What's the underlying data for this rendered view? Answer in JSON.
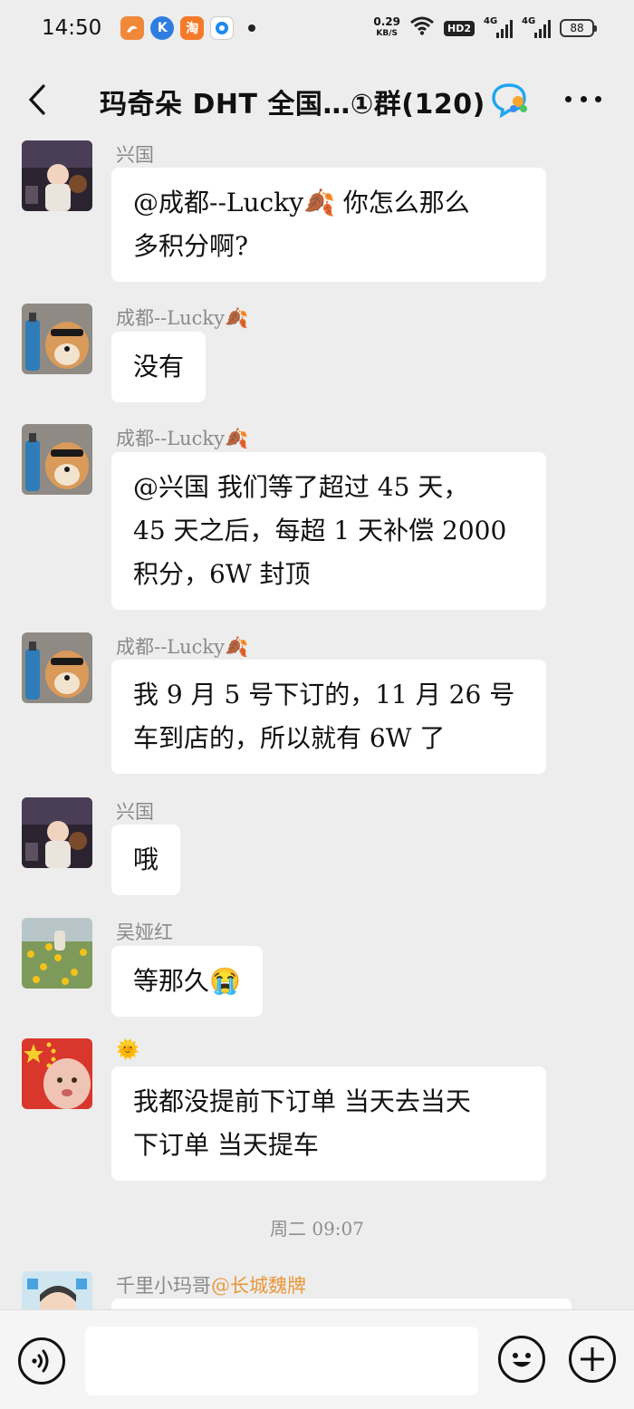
{
  "status_bar": {
    "time": "14:50",
    "net_speed_value": "0.29",
    "net_speed_unit": "KB/S",
    "hd_label": "HD2",
    "signal1_label": "4G",
    "signal2_label": "4G",
    "battery": "88",
    "app_icons": [
      "uc-browser-icon",
      "k-app-icon",
      "taobao-icon",
      "circle-app-icon"
    ]
  },
  "header": {
    "title": "玛奇朵 DHT 全国…①群(120)"
  },
  "messages": [
    {
      "sender": "兴国",
      "avatar": "child-photo",
      "lines": [
        "@成都--Lucky🍂  你怎么那么",
        "多积分啊?"
      ]
    },
    {
      "sender": "成都--Lucky🍂",
      "avatar": "dog-photo",
      "lines": [
        "没有"
      ]
    },
    {
      "sender": "成都--Lucky🍂",
      "avatar": "dog-photo",
      "lines": [
        "@兴国  我们等了超过 45 天，",
        "45 天之后，每超 1 天补偿 2000",
        "积分，6W 封顶"
      ]
    },
    {
      "sender": "成都--Lucky🍂",
      "avatar": "dog-photo",
      "lines": [
        "我 9 月 5 号下订的，11 月 26 号",
        "车到店的，所以就有 6W 了"
      ]
    },
    {
      "sender": "兴国",
      "avatar": "child-photo",
      "lines": [
        "哦"
      ]
    },
    {
      "sender": "吴娅红",
      "avatar": "flower-photo",
      "lines": [
        "等那久😭"
      ]
    },
    {
      "sender": "🌞",
      "avatar": "flag-child-photo",
      "lines": [
        "我都没提前下订单 当天去当天",
        "下订单 当天提车"
      ]
    }
  ],
  "time_divider": "周二 09:07",
  "last_message": {
    "sender": "千里小玛哥",
    "mention": "@长城魏牌",
    "avatar": "cartoon-avatar"
  },
  "input_bar": {
    "placeholder": ""
  },
  "colors": {
    "background": "#ededed",
    "bubble": "#ffffff",
    "sender_name": "#8a8a8a",
    "mention": "#e8973a"
  }
}
